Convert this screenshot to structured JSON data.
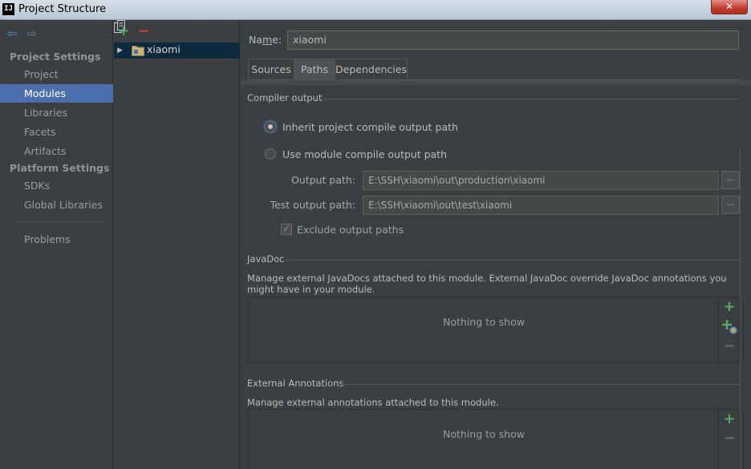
{
  "window": {
    "logo": "IJ",
    "title": "Project Structure",
    "close": "✕"
  },
  "nav": {
    "project_settings": "Project Settings",
    "project_items": [
      "Project",
      "Modules",
      "Libraries",
      "Facets",
      "Artifacts"
    ],
    "platform_settings": "Platform Settings",
    "platform_items": [
      "SDKs",
      "Global Libraries"
    ],
    "problems": "Problems",
    "selected": "Modules"
  },
  "tree": {
    "module": "xiaomi",
    "toolbar_icons": [
      "add-icon",
      "remove-icon",
      "copy-icon"
    ]
  },
  "module": {
    "name_label_pre": "Na",
    "name_label_mnemonic": "m",
    "name_label_post": "e:",
    "name_value": "xiaomi",
    "tabs": [
      "Sources",
      "Paths",
      "Dependencies"
    ],
    "active_tab": "Paths"
  },
  "compiler": {
    "section": "Compiler output",
    "inherit_label": "Inherit project compile output path",
    "module_label": "Use module compile output path",
    "selected": "inherit",
    "output_label": "Output path:",
    "output_value": "E:\\SSH\\xiaomi\\out\\production\\xiaomi",
    "test_label": "Test output path:",
    "test_value": "E:\\SSH\\xiaomi\\out\\test\\xiaomi",
    "browse": "...",
    "exclude_label": "Exclude output paths",
    "exclude_checked": true
  },
  "javadoc": {
    "section": "JavaDoc",
    "description": "Manage external JavaDocs attached to this module. External JavaDoc override JavaDoc annotations you might have in your module.",
    "empty": "Nothing to show"
  },
  "annotations": {
    "section": "External Annotations",
    "description": "Manage external annotations attached to this module.",
    "empty": "Nothing to show"
  },
  "colors": {
    "selection": "#4b6eaf",
    "add": "#59a869",
    "remove": "#d0453b",
    "background": "#3c3f41"
  }
}
